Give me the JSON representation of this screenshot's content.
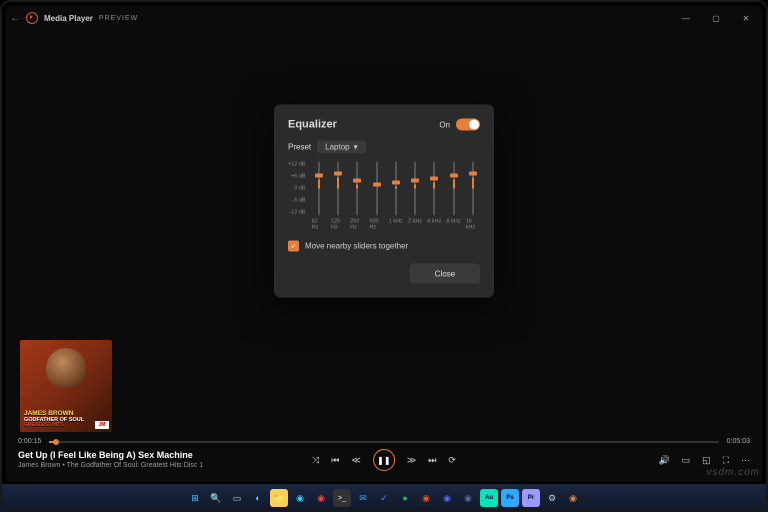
{
  "titlebar": {
    "appName": "Media Player",
    "preview": "PREVIEW"
  },
  "album": {
    "l1": "JAMES BROWN",
    "l2": "GODFATHER OF SOUL",
    "l3": "GREATEST HITS",
    "logo": "JM"
  },
  "track": {
    "title": "Get Up (I Feel Like Being A) Sex Machine",
    "artist": "James Brown • The Godfather Of Soul: Greatest Hits Disc 1",
    "elapsed": "0:00:15",
    "total": "0:05:03"
  },
  "dialog": {
    "title": "Equalizer",
    "onLabel": "On",
    "presetLabel": "Preset",
    "presetValue": "Laptop",
    "moveLabel": "Move nearby sliders together",
    "close": "Close",
    "scale": [
      "+12 dB",
      "+6 dB",
      "0 dB",
      "-6 dB",
      "-12 dB"
    ],
    "bands": [
      {
        "hz": "62 Hz",
        "db": 4
      },
      {
        "hz": "125 Hz",
        "db": 5
      },
      {
        "hz": "250 Hz",
        "db": 2
      },
      {
        "hz": "500 Hz",
        "db": 0
      },
      {
        "hz": "1 kHz",
        "db": 1
      },
      {
        "hz": "2 kHz",
        "db": 2
      },
      {
        "hz": "4 kHz",
        "db": 3
      },
      {
        "hz": "8 kHz",
        "db": 4
      },
      {
        "hz": "16 kHz",
        "db": 5
      }
    ]
  },
  "watermark": "vsdm.com"
}
